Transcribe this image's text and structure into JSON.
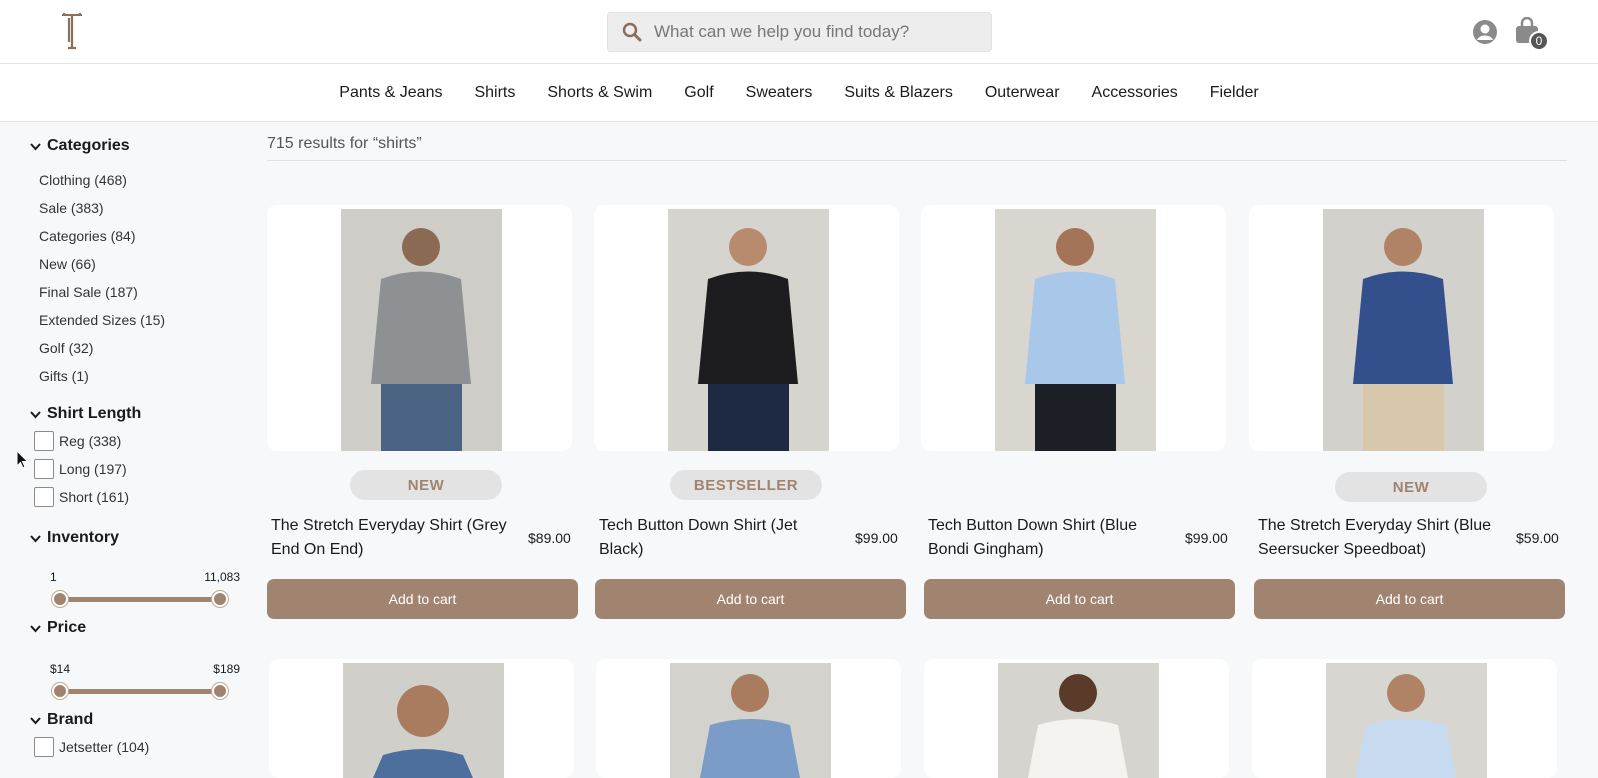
{
  "header": {
    "search_placeholder": "What can we help you find today?",
    "cart_count": "0"
  },
  "nav": [
    "Pants & Jeans",
    "Shirts",
    "Shorts & Swim",
    "Golf",
    "Sweaters",
    "Suits & Blazers",
    "Outerwear",
    "Accessories",
    "Fielder"
  ],
  "filters": {
    "categories": {
      "title": "Categories",
      "items": [
        "Clothing (468)",
        "Sale (383)",
        "Categories (84)",
        "New (66)",
        "Final Sale (187)",
        "Extended Sizes (15)",
        "Golf (32)",
        "Gifts (1)"
      ]
    },
    "shirt_length": {
      "title": "Shirt Length",
      "items": [
        "Reg (338)",
        "Long (197)",
        "Short (161)"
      ]
    },
    "inventory": {
      "title": "Inventory",
      "min": "1",
      "max": "11,083"
    },
    "price": {
      "title": "Price",
      "min": "$14",
      "max": "$189"
    },
    "brand": {
      "title": "Brand",
      "items": [
        "Jetsetter (104)"
      ]
    }
  },
  "results_text": "715 results for “shirts”",
  "products": [
    {
      "badge": "NEW",
      "name": "The Stretch Everyday Shirt (Grey End On End)",
      "price": "$89.00",
      "button": "Add to cart",
      "shirt_color": "#8e9194",
      "pants_color": "#4b6382"
    },
    {
      "badge": "BESTSELLER",
      "name": "Tech Button Down Shirt (Jet Black)",
      "price": "$99.00",
      "button": "Add to cart",
      "shirt_color": "#1d1d1f",
      "pants_color": "#1e2a44"
    },
    {
      "badge": "",
      "name": "Tech Button Down Shirt (Blue Bondi Gingham)",
      "price": "$99.00",
      "button": "Add to cart",
      "shirt_color": "#a9c7e9",
      "pants_color": "#1c1f26"
    },
    {
      "badge": "NEW",
      "name": "The Stretch Everyday Shirt (Blue Seersucker Speedboat)",
      "price": "$59.00",
      "button": "Add to cart",
      "shirt_color": "#33508d",
      "pants_color": "#d8c7ab"
    }
  ],
  "second_row": [
    {
      "shirt_color": "#4c6f9e"
    },
    {
      "shirt_color": "#7b9cc7"
    },
    {
      "shirt_color": "#f4f3ef"
    },
    {
      "shirt_color": "#c7daef"
    }
  ]
}
